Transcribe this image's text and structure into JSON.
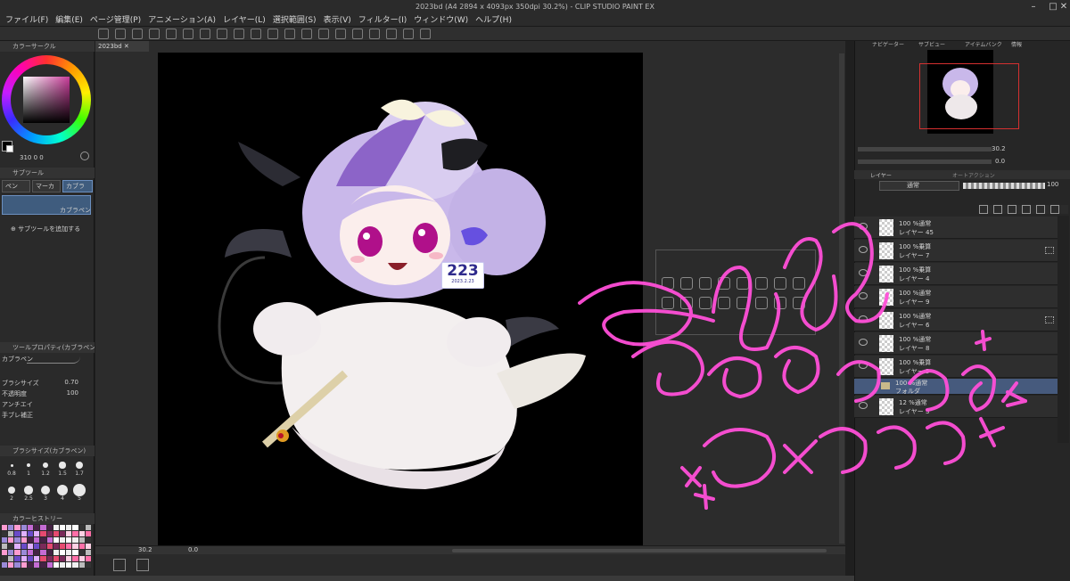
{
  "app": {
    "title": "2023bd (A4 2894 x 4093px 350dpi 30.2%) - CLIP STUDIO PAINT EX"
  },
  "menu": [
    "ファイル(F)",
    "編集(E)",
    "ページ管理(P)",
    "アニメーション(A)",
    "レイヤー(L)",
    "選択範囲(S)",
    "表示(V)",
    "フィルター(I)",
    "ウィンドウ(W)",
    "ヘルプ(H)"
  ],
  "left": {
    "color_panel_tab": "カラーサークル",
    "color_values": "310  0  0",
    "subtool_tab": "サブツール",
    "subtool_buttons": [
      "ペン",
      "マーカ",
      "カブラ"
    ],
    "selected_brush": "カブラペン",
    "add_subtool": "サブツールを追加する",
    "prop_tab": "ツールプロパティ(カブラペン)",
    "prop_brush": "カブラペン",
    "props": [
      {
        "label": "ブラシサイズ",
        "value": "0.70"
      },
      {
        "label": "不透明度",
        "value": "100"
      },
      {
        "label": "アンチエイ",
        "value": ""
      },
      {
        "label": "手ブレ補正",
        "value": ""
      }
    ],
    "brushsize_tab": "ブラシサイズ(カブラペン)",
    "brush_sizes_row1": [
      "0.8",
      "1",
      "1.2",
      "1.5",
      "1.7"
    ],
    "brush_sizes_row2": [
      "2",
      "2.5",
      "3",
      "4",
      "5"
    ],
    "history_tab": "カラーヒストリー"
  },
  "canvas": {
    "doc_tab": "2023bd",
    "zoom": "30.2",
    "angle": "0.0",
    "badge_text": "223",
    "badge_sub": "2023.2.23"
  },
  "right": {
    "tabs_top": [
      "ナビゲーター",
      "サブビュー",
      "アイテムバンク",
      "情報"
    ],
    "nav_zoom": "30.2",
    "nav_angle": "0.0",
    "tabs_layer": [
      "レイヤー",
      "オートアクション"
    ],
    "blend_mode": "通常",
    "opacity": "100",
    "layers": [
      {
        "top": "100 %通常",
        "name": "レイヤー 45"
      },
      {
        "top": "100 %乗算",
        "name": "レイヤー 7"
      },
      {
        "top": "100 %乗算",
        "name": "レイヤー 4"
      },
      {
        "top": "100 %通常",
        "name": "レイヤー 9"
      },
      {
        "top": "100 %通常",
        "name": "レイヤー 6"
      },
      {
        "top": "100 %通常",
        "name": "レイヤー 8"
      },
      {
        "top": "100 %乗算",
        "name": "レイヤー 5"
      }
    ],
    "folder": {
      "top": "100 %通常",
      "name": "フォルダ"
    },
    "extra_layer": {
      "top": "12 %通常",
      "name": "レイヤー 3"
    }
  },
  "colors": {
    "accent": "#3f5c7e",
    "signature": "#ff4fd8",
    "hair": "#c9b8ea",
    "eyes": "#b0108a"
  }
}
